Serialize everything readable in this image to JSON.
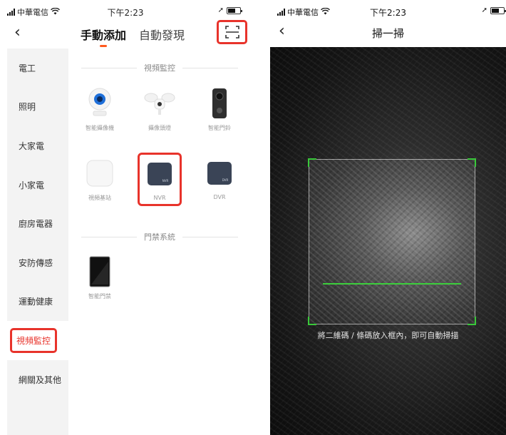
{
  "left": {
    "status": {
      "carrier": "中華電信",
      "time": "下午2:23"
    },
    "nav": {
      "tab_manual": "手動添加",
      "tab_auto": "自動發現"
    },
    "sidebar": [
      {
        "label": "電工"
      },
      {
        "label": "照明"
      },
      {
        "label": "大家電"
      },
      {
        "label": "小家電"
      },
      {
        "label": "廚房電器"
      },
      {
        "label": "安防傳感"
      },
      {
        "label": "運動健康"
      },
      {
        "label": "視頻監控"
      },
      {
        "label": "網關及其他"
      }
    ],
    "section_video": "視頻監控",
    "section_access": "門禁系統",
    "devices": {
      "smart_camera": "智能攝像機",
      "camera_light": "攝像頭燈",
      "smart_doorbell": "智能門鈴",
      "video_base": "視頻基站",
      "nvr": "NVR",
      "dvr": "DVR",
      "smart_door_lock": "智能門禁"
    }
  },
  "right": {
    "status": {
      "carrier": "中華電信",
      "time": "下午2:23"
    },
    "title": "掃一掃",
    "hint": "將二維碼 / 條碼放入框內，即可自動掃描"
  },
  "colors": {
    "accent_red": "#e8332b",
    "tab_underline": "#ff5a1f",
    "scan_green": "#3ccf3c"
  },
  "icons": [
    "signal-icon",
    "wifi-icon",
    "location-icon",
    "battery-icon",
    "back-icon",
    "scan-icon"
  ]
}
